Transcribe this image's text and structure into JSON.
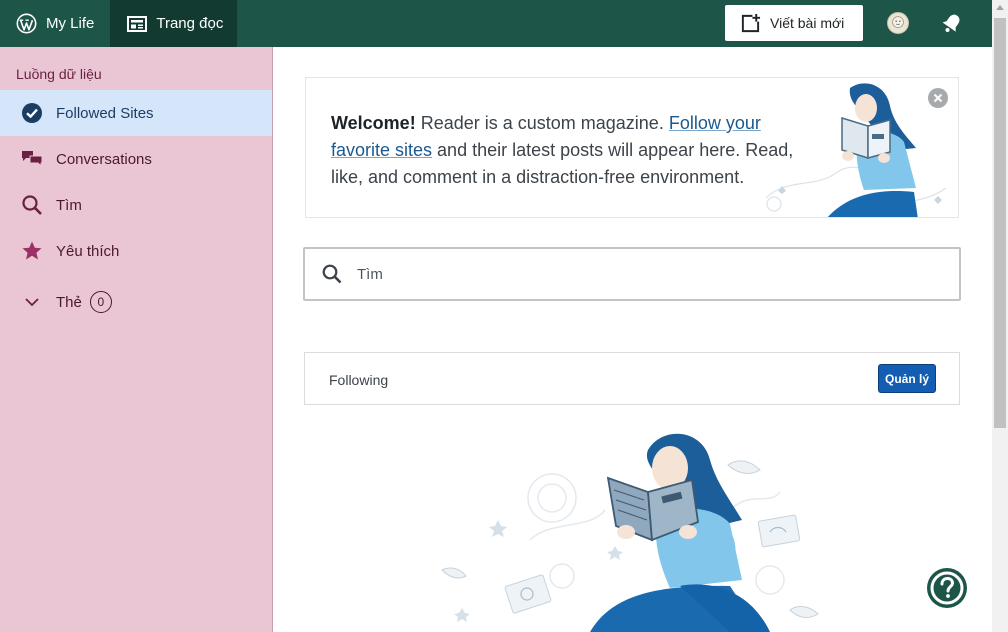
{
  "topbar": {
    "my_site_label": "My Life",
    "reader_label": "Trang đọc",
    "write_label": "Viết bài mới",
    "bg_color": "#1d5548",
    "icons": [
      "wordpress-icon",
      "reader-icon",
      "write-post-icon",
      "avatar",
      "notifications-bell-icon"
    ]
  },
  "sidebar": {
    "heading": "Luồng dữ liệu",
    "items": [
      {
        "label": "Followed Sites",
        "icon": "checkmark-circle-icon",
        "active": true
      },
      {
        "label": "Conversations",
        "icon": "conversations-icon"
      },
      {
        "label": "Tìm",
        "icon": "search-icon"
      },
      {
        "label": "Yêu thích",
        "icon": "star-icon"
      },
      {
        "label": "Thẻ",
        "icon": "chevron-down-icon",
        "count": "0"
      }
    ],
    "bg_color": "#eac6d4",
    "active_bg_color": "#d5e6fb"
  },
  "welcome": {
    "bold": "Welcome!",
    "text1": " Reader is a custom magazine. ",
    "link": "Follow your favorite sites",
    "text2": " and their latest posts will appear here. Read, like, and comment in a distraction-free environment."
  },
  "search": {
    "placeholder": "Tìm"
  },
  "following": {
    "label": "Following",
    "manage_label": "Quản lý"
  },
  "help": {
    "icon": "help-question-icon"
  }
}
